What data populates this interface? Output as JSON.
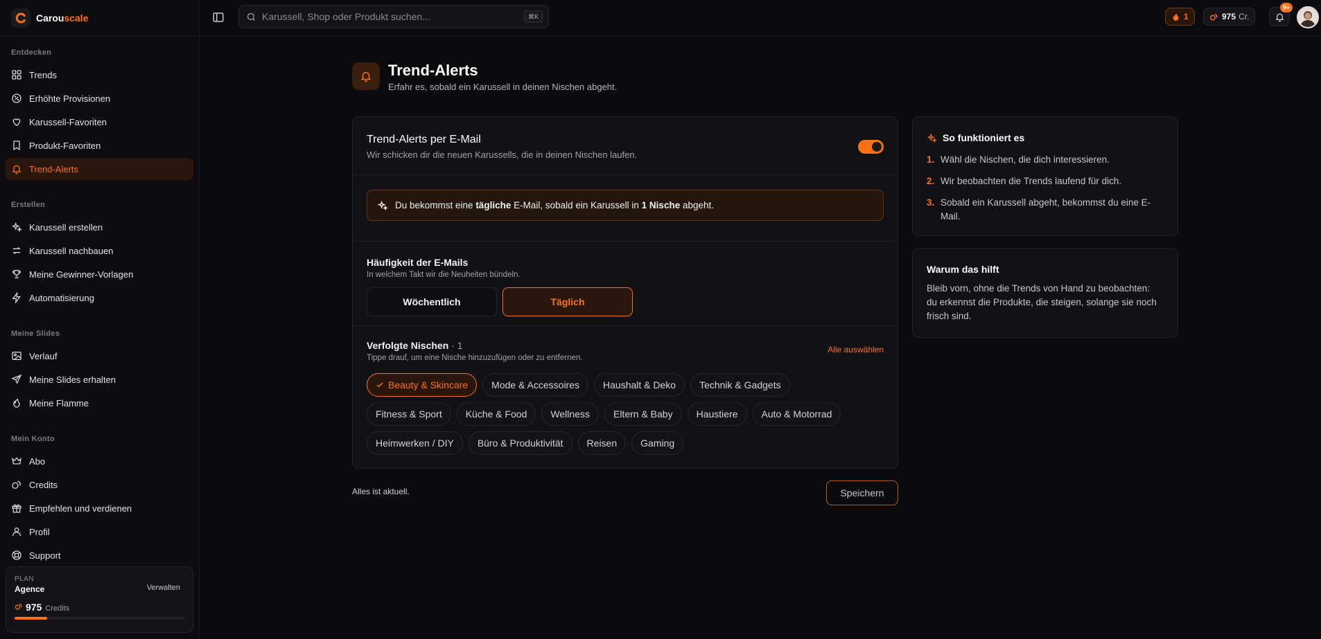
{
  "brand": {
    "name_part1": "Carou",
    "name_part2": "scale"
  },
  "nav": {
    "sections": [
      {
        "title": "Entdecken",
        "items": [
          {
            "label": "Trends",
            "icon": "grid-icon"
          },
          {
            "label": "Erhöhte Provisionen",
            "icon": "percent-badge-icon"
          },
          {
            "label": "Karussell-Favoriten",
            "icon": "heart-icon"
          },
          {
            "label": "Produkt-Favoriten",
            "icon": "bookmark-icon"
          },
          {
            "label": "Trend-Alerts",
            "icon": "bell-icon",
            "active": true
          }
        ]
      },
      {
        "title": "Erstellen",
        "items": [
          {
            "label": "Karussell erstellen",
            "icon": "sparkles-icon"
          },
          {
            "label": "Karussell nachbauen",
            "icon": "repeat-icon"
          },
          {
            "label": "Meine Gewinner-Vorlagen",
            "icon": "trophy-icon"
          },
          {
            "label": "Automatisierung",
            "icon": "zap-icon"
          }
        ]
      },
      {
        "title": "Meine Slides",
        "items": [
          {
            "label": "Verlauf",
            "icon": "image-icon"
          },
          {
            "label": "Meine Slides erhalten",
            "icon": "send-icon"
          },
          {
            "label": "Meine Flamme",
            "icon": "flame-icon"
          }
        ]
      },
      {
        "title": "Mein Konto",
        "items": [
          {
            "label": "Abo",
            "icon": "crown-icon"
          },
          {
            "label": "Credits",
            "icon": "coins-icon"
          },
          {
            "label": "Empfehlen und verdienen",
            "icon": "gift-icon"
          },
          {
            "label": "Profil",
            "icon": "user-icon"
          },
          {
            "label": "Support",
            "icon": "lifebuoy-icon"
          }
        ]
      }
    ]
  },
  "plan": {
    "label": "PLAN",
    "name": "Agence",
    "manage": "Verwalten",
    "credits": "975",
    "credits_label": "Credits",
    "progress_fraction": 0.19
  },
  "topbar": {
    "search_placeholder": "Karussell, Shop oder Produkt suchen...",
    "shortcut": "⌘K",
    "streak": "1",
    "credits": "975",
    "credits_unit": "Cr.",
    "notifications_badge": "9+"
  },
  "page": {
    "title": "Trend-Alerts",
    "subtitle": "Erfahr es, sobald ein Karussell in deinen Nischen abgeht."
  },
  "email_alerts": {
    "title": "Trend-Alerts per E-Mail",
    "description": "Wir schicken dir die neuen Karussells, die in deinen Nischen laufen.",
    "enabled": true
  },
  "notice": {
    "part1": "Du bekommst eine ",
    "bold1": "tägliche",
    "part2": " E-Mail, sobald ein Karussell in ",
    "bold2": "1 Nische",
    "part3": " abgeht."
  },
  "frequency": {
    "title": "Häufigkeit der E-Mails",
    "description": "In welchem Takt wir die Neuheiten bündeln.",
    "weekly": "Wöchentlich",
    "daily": "Täglich",
    "selected": "daily"
  },
  "niches": {
    "title": "Verfolgte Nischen",
    "count": "· 1",
    "description": "Tippe drauf, um eine Nische hinzuzufügen oder zu entfernen.",
    "select_all": "Alle auswählen",
    "rows": [
      [
        {
          "label": "Beauty & Skincare",
          "selected": true
        },
        {
          "label": "Mode & Accessoires"
        },
        {
          "label": "Haushalt & Deko"
        },
        {
          "label": "Technik & Gadgets"
        }
      ],
      [
        {
          "label": "Fitness & Sport"
        },
        {
          "label": "Küche & Food"
        },
        {
          "label": "Wellness"
        },
        {
          "label": "Eltern & Baby"
        },
        {
          "label": "Haustiere"
        },
        {
          "label": "Auto & Motorrad"
        }
      ],
      [
        {
          "label": "Heimwerken / DIY"
        },
        {
          "label": "Büro & Produktivität"
        },
        {
          "label": "Reisen"
        },
        {
          "label": "Gaming"
        }
      ]
    ]
  },
  "footer": {
    "status": "Alles ist aktuell.",
    "save": "Speichern"
  },
  "how_it_works": {
    "title": "So funktioniert es",
    "steps": [
      {
        "num": "1.",
        "text": "Wähl die Nischen, die dich interessieren."
      },
      {
        "num": "2.",
        "text": "Wir beobachten die Trends laufend für dich."
      },
      {
        "num": "3.",
        "text": "Sobald ein Karussell abgeht, bekommst du eine E-Mail."
      }
    ]
  },
  "why": {
    "title": "Warum das hilft",
    "text": "Bleib vorn, ohne die Trends von Hand zu beobachten: du erkennst die Produkte, die steigen, solange sie noch frisch sind."
  },
  "colors": {
    "accent": "#f97316",
    "background": "#0b0b0d",
    "card": "#121216"
  }
}
